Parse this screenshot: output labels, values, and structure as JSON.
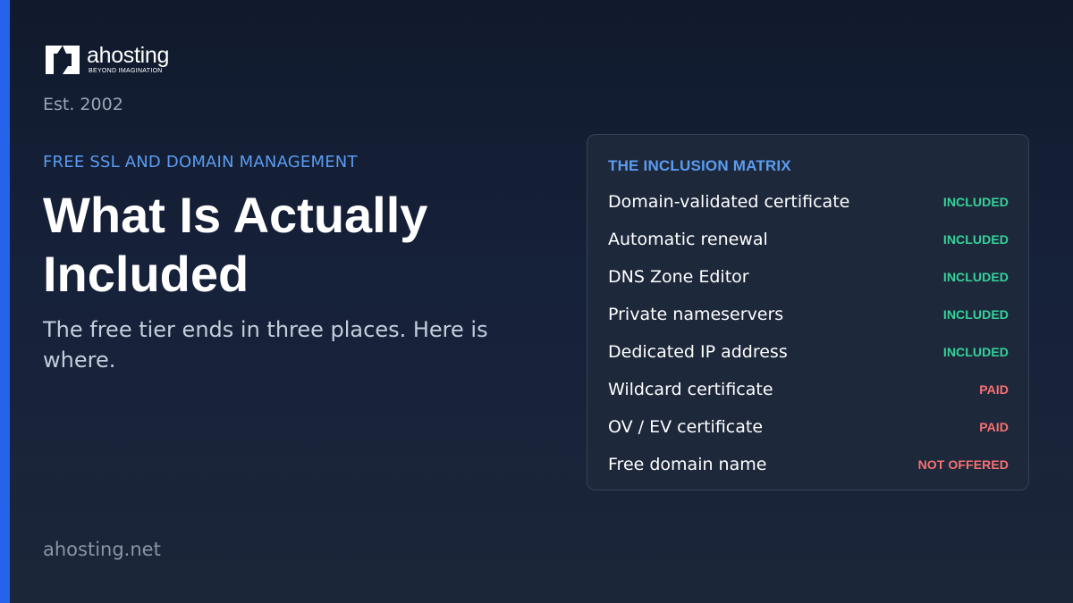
{
  "brand": {
    "name": "ahosting",
    "tagline": "BEYOND IMAGINATION",
    "established": "Est. 2002",
    "site": "ahosting.net"
  },
  "hero": {
    "eyebrow": "FREE SSL AND DOMAIN MANAGEMENT",
    "title": "What Is Actually Included",
    "subtitle": "The free tier ends in three places. Here is where."
  },
  "matrix": {
    "heading": "THE INCLUSION MATRIX",
    "rows": [
      {
        "feature": "Domain-validated certificate",
        "status": "INCLUDED",
        "color": "#34d399"
      },
      {
        "feature": "Automatic renewal",
        "status": "INCLUDED",
        "color": "#34d399"
      },
      {
        "feature": "DNS Zone Editor",
        "status": "INCLUDED",
        "color": "#34d399"
      },
      {
        "feature": "Private nameservers",
        "status": "INCLUDED",
        "color": "#34d399"
      },
      {
        "feature": "Dedicated IP address",
        "status": "INCLUDED",
        "color": "#34d399"
      },
      {
        "feature": "Wildcard certificate",
        "status": "PAID",
        "color": "#f87171"
      },
      {
        "feature": "OV / EV certificate",
        "status": "PAID",
        "color": "#f87171"
      },
      {
        "feature": "Free domain name",
        "status": "NOT OFFERED",
        "color": "#f87171"
      }
    ]
  },
  "colors": {
    "accent": "#2563eb",
    "eyebrow": "#5b9cf0",
    "included": "#34d399",
    "paid": "#f87171"
  },
  "icons": {
    "logo": "ahosting-logo-mark"
  }
}
